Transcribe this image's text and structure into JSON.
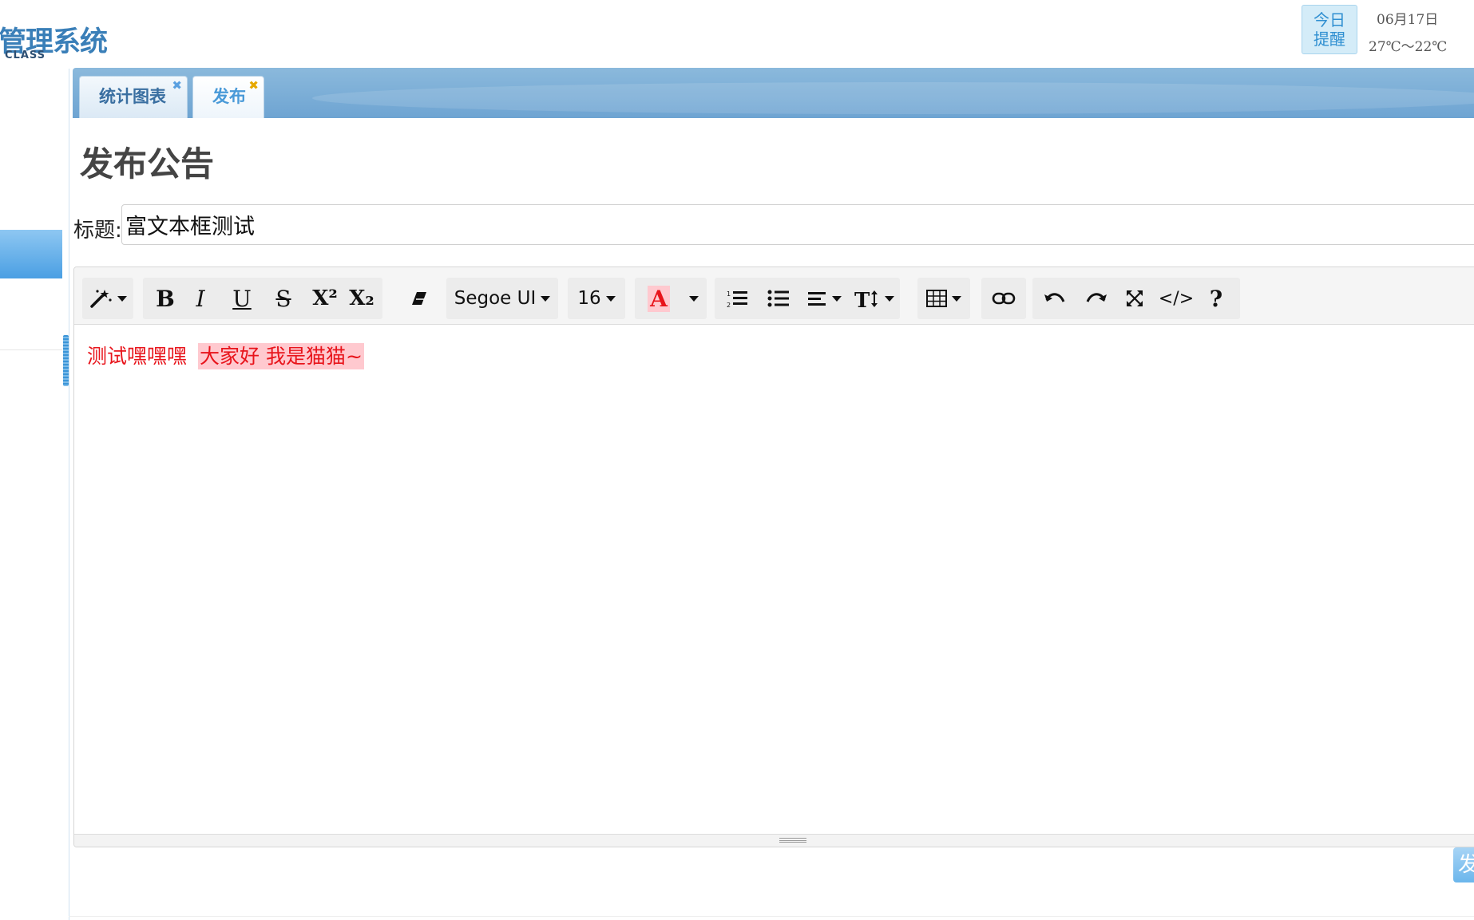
{
  "header": {
    "logo_text": "管理系统",
    "logo_sub": "CLASS",
    "remind_line1": "今日",
    "remind_line2": "提醒",
    "date": "06月17日",
    "weather": "27℃～22℃"
  },
  "tabs": [
    {
      "label": "统计图表",
      "close": "✖"
    },
    {
      "label": "发布",
      "close": "✖"
    }
  ],
  "page": {
    "title": "发布公告",
    "field_label": "标题:",
    "title_value": "富文本框测试"
  },
  "toolbar": {
    "font_name": "Segoe UI",
    "font_size": "16",
    "bold": "B",
    "italic": "I",
    "underline": "U",
    "strike": "S",
    "superscript": "X²",
    "subscript": "X₂",
    "color_letter": "A",
    "code": "</>",
    "help": "?",
    "color_accent": "#e8141b"
  },
  "editor": {
    "text_plain": "测试嘿嘿嘿",
    "text_highlighted": "大家好 我是猫猫~"
  },
  "publish_button": "发"
}
